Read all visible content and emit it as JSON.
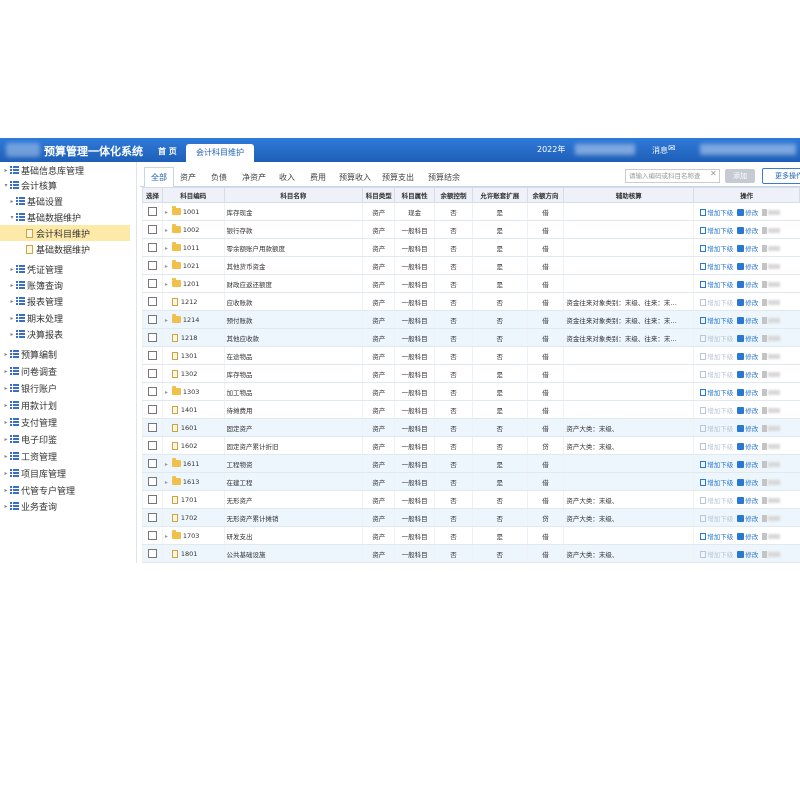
{
  "header": {
    "title": "预算管理一体化系统",
    "nav_home": "首 页",
    "active_tab": "会计科目维护",
    "year": "2022年",
    "messages": "消息"
  },
  "sidebar": {
    "items": [
      {
        "label": "基础信息库管理",
        "level": 0
      },
      {
        "label": "会计核算",
        "level": 0
      },
      {
        "label": "基础设置",
        "level": 1
      },
      {
        "label": "基础数据维护",
        "level": 1
      },
      {
        "label": "会计科目维护",
        "level": 2,
        "active": true
      },
      {
        "label": "基础数据维护",
        "level": 2
      },
      {
        "label": "凭证管理",
        "level": 1
      },
      {
        "label": "账簿查询",
        "level": 1
      },
      {
        "label": "报表管理",
        "level": 1
      },
      {
        "label": "期末处理",
        "level": 1
      },
      {
        "label": "决算报表",
        "level": 1
      },
      {
        "label": "预算编制",
        "level": 0
      },
      {
        "label": "问卷调查",
        "level": 0
      },
      {
        "label": "银行账户",
        "level": 0
      },
      {
        "label": "用款计划",
        "level": 0
      },
      {
        "label": "支付管理",
        "level": 0
      },
      {
        "label": "电子印鉴",
        "level": 0
      },
      {
        "label": "工资管理",
        "level": 0
      },
      {
        "label": "项目库管理",
        "level": 0
      },
      {
        "label": "代管专户管理",
        "level": 0
      },
      {
        "label": "业务查询",
        "level": 0
      }
    ]
  },
  "toolbar": {
    "tabs": [
      "全部",
      "资产",
      "负债",
      "净资产",
      "收入",
      "费用",
      "预算收入",
      "预算支出",
      "预算结余"
    ],
    "search_placeholder": "请输入编码或科目名称查",
    "add_label": "添加",
    "more_label": "更多操作"
  },
  "table": {
    "columns": [
      "选择",
      "科目编码",
      "科目名称",
      "科目类型",
      "科目属性",
      "余额控制",
      "允许账套扩展",
      "余额方向",
      "辅助核算",
      "操作"
    ],
    "op_add": "增加下级",
    "op_edit": "修改",
    "rows": [
      {
        "code": "1001",
        "name": "库存现金",
        "type": "资产",
        "attr": "现金",
        "ctrl": "否",
        "ext": "是",
        "dir": "借",
        "aux": "",
        "folder": true
      },
      {
        "code": "1002",
        "name": "银行存款",
        "type": "资产",
        "attr": "一般科目",
        "ctrl": "否",
        "ext": "是",
        "dir": "借",
        "aux": "",
        "folder": true
      },
      {
        "code": "1011",
        "name": "零余额账户用款额度",
        "type": "资产",
        "attr": "一般科目",
        "ctrl": "否",
        "ext": "是",
        "dir": "借",
        "aux": "",
        "folder": true
      },
      {
        "code": "1021",
        "name": "其他货币资金",
        "type": "资产",
        "attr": "一般科目",
        "ctrl": "否",
        "ext": "是",
        "dir": "借",
        "aux": "",
        "folder": true
      },
      {
        "code": "1201",
        "name": "财政应返还额度",
        "type": "资产",
        "attr": "一般科目",
        "ctrl": "否",
        "ext": "是",
        "dir": "借",
        "aux": "",
        "folder": true
      },
      {
        "code": "1212",
        "name": "应收账款",
        "type": "资产",
        "attr": "一般科目",
        "ctrl": "否",
        "ext": "否",
        "dir": "借",
        "aux": "资金往来对象类别：末级、往来：末…",
        "folder": false
      },
      {
        "code": "1214",
        "name": "预付账款",
        "type": "资产",
        "attr": "一般科目",
        "ctrl": "否",
        "ext": "否",
        "dir": "借",
        "aux": "资金往来对象类别：末级、往来：末…",
        "folder": true
      },
      {
        "code": "1218",
        "name": "其他应收款",
        "type": "资产",
        "attr": "一般科目",
        "ctrl": "否",
        "ext": "否",
        "dir": "借",
        "aux": "资金往来对象类别：末级、往来：末…",
        "folder": false
      },
      {
        "code": "1301",
        "name": "在途物品",
        "type": "资产",
        "attr": "一般科目",
        "ctrl": "否",
        "ext": "否",
        "dir": "借",
        "aux": "",
        "folder": false
      },
      {
        "code": "1302",
        "name": "库存物品",
        "type": "资产",
        "attr": "一般科目",
        "ctrl": "否",
        "ext": "是",
        "dir": "借",
        "aux": "",
        "folder": false
      },
      {
        "code": "1303",
        "name": "加工物品",
        "type": "资产",
        "attr": "一般科目",
        "ctrl": "否",
        "ext": "是",
        "dir": "借",
        "aux": "",
        "folder": true
      },
      {
        "code": "1401",
        "name": "待摊费用",
        "type": "资产",
        "attr": "一般科目",
        "ctrl": "否",
        "ext": "是",
        "dir": "借",
        "aux": "",
        "folder": false
      },
      {
        "code": "1601",
        "name": "固定资产",
        "type": "资产",
        "attr": "一般科目",
        "ctrl": "否",
        "ext": "否",
        "dir": "借",
        "aux": "资产大类：末级、",
        "folder": false
      },
      {
        "code": "1602",
        "name": "固定资产累计折旧",
        "type": "资产",
        "attr": "一般科目",
        "ctrl": "否",
        "ext": "否",
        "dir": "贷",
        "aux": "资产大类：末级、",
        "folder": false
      },
      {
        "code": "1611",
        "name": "工程物资",
        "type": "资产",
        "attr": "一般科目",
        "ctrl": "否",
        "ext": "是",
        "dir": "借",
        "aux": "",
        "folder": true
      },
      {
        "code": "1613",
        "name": "在建工程",
        "type": "资产",
        "attr": "一般科目",
        "ctrl": "否",
        "ext": "是",
        "dir": "借",
        "aux": "",
        "folder": true
      },
      {
        "code": "1701",
        "name": "无形资产",
        "type": "资产",
        "attr": "一般科目",
        "ctrl": "否",
        "ext": "否",
        "dir": "借",
        "aux": "资产大类：末级、",
        "folder": false
      },
      {
        "code": "1702",
        "name": "无形资产累计摊销",
        "type": "资产",
        "attr": "一般科目",
        "ctrl": "否",
        "ext": "否",
        "dir": "贷",
        "aux": "资产大类：末级、",
        "folder": false
      },
      {
        "code": "1703",
        "name": "研发支出",
        "type": "资产",
        "attr": "一般科目",
        "ctrl": "否",
        "ext": "是",
        "dir": "借",
        "aux": "",
        "folder": true
      },
      {
        "code": "1801",
        "name": "公共基础设施",
        "type": "资产",
        "attr": "一般科目",
        "ctrl": "否",
        "ext": "否",
        "dir": "借",
        "aux": "资产大类：末级、",
        "folder": false
      }
    ]
  }
}
